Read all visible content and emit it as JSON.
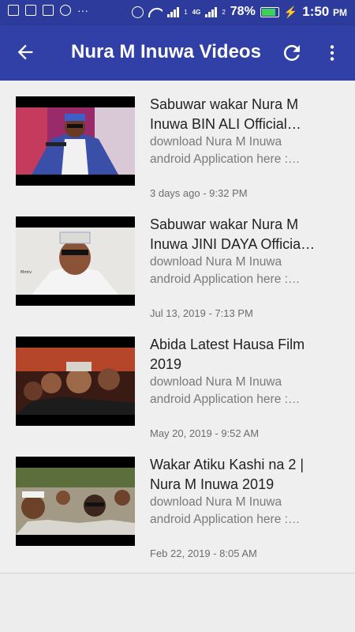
{
  "status_bar": {
    "battery_text": "78%",
    "battery_level": 0.78,
    "time": "1:50",
    "time_suffix": "PM",
    "signal_a": "1",
    "signal_b": "4G",
    "signal_c": "2",
    "more_notifications": "···",
    "battery_color": "#3ed05a"
  },
  "app_bar": {
    "title": "Nura M Inuwa Videos",
    "back_icon": "arrow-back-icon",
    "refresh_icon": "refresh-icon",
    "more_icon": "more-vert-icon",
    "color": "#3040a6"
  },
  "videos": [
    {
      "title_line1": "Sabuwar wakar Nura M",
      "title_line2": "Inuwa BIN ALI Official…",
      "desc_line1": "download Nura M Inuwa",
      "desc_line2": "android Application here :…",
      "date": "3 days ago - 9:32 PM"
    },
    {
      "title_line1": "Sabuwar wakar Nura M",
      "title_line2": "Inuwa JINI DAYA Officia…",
      "desc_line1": "download Nura M Inuwa",
      "desc_line2": "android Application here :…",
      "date": "Jul 13, 2019 - 7:13 PM"
    },
    {
      "title_line1": "Abida Latest Hausa Film",
      "title_line2": "2019",
      "desc_line1": "download Nura M Inuwa",
      "desc_line2": "android Application here :…",
      "date": "May 20, 2019 - 9:52 AM"
    },
    {
      "title_line1": "Wakar Atiku Kashi na 2 |",
      "title_line2": "Nura M Inuwa 2019",
      "desc_line1": "download Nura M Inuwa",
      "desc_line2": "android Application here :…",
      "date": "Feb 22, 2019 - 8:05 AM"
    }
  ]
}
